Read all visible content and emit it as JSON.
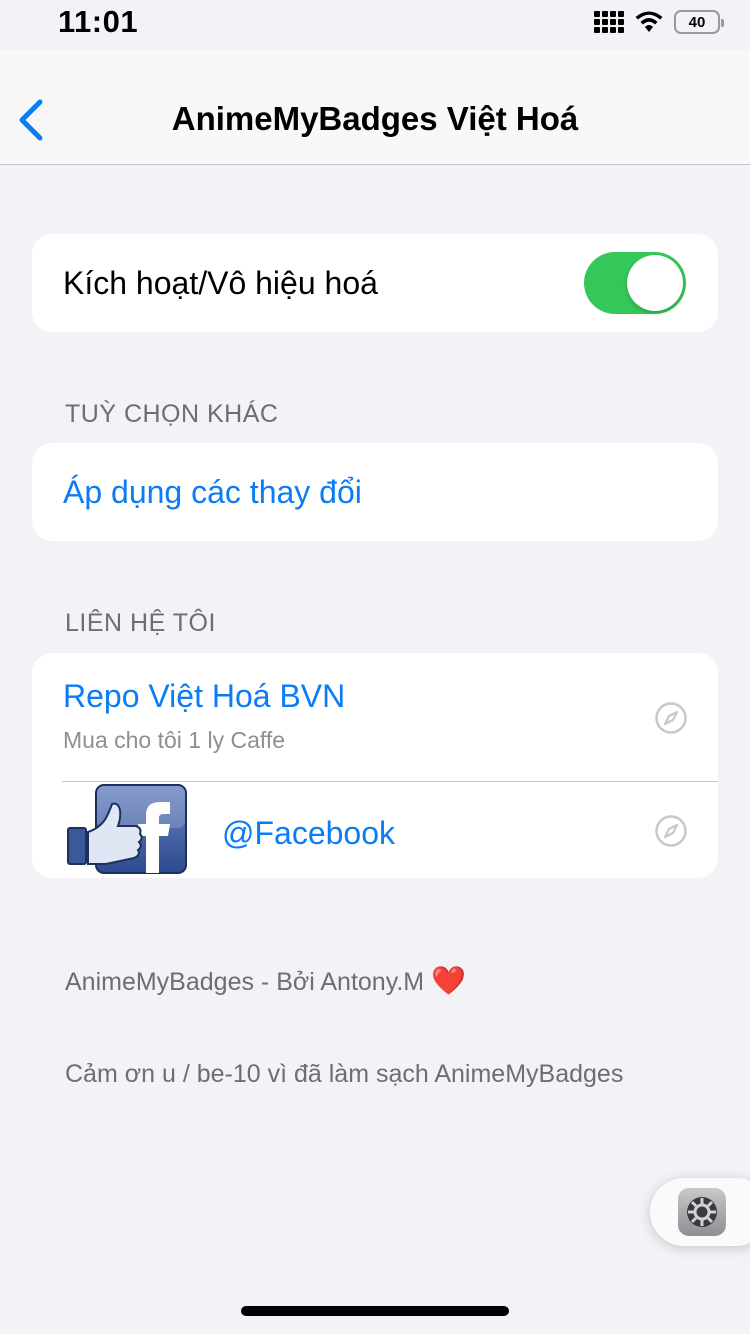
{
  "status_bar": {
    "time": "11:01",
    "battery": "40",
    "icons": [
      "signal-icon",
      "wifi-icon",
      "battery-icon"
    ]
  },
  "navbar": {
    "title": "AnimeMyBadges Việt Hoá",
    "back_icon": "chevron-left-icon"
  },
  "toggle_row": {
    "label": "Kích hoạt/Vô hiệu hoá",
    "enabled": true
  },
  "sections": {
    "other_options": "TUỲ CHỌN KHÁC",
    "contact": "LIÊN HỆ TÔI"
  },
  "apply": {
    "label": "Áp dụng các thay đổi"
  },
  "contact_rows": [
    {
      "title": "Repo Việt Hoá BVN",
      "subtitle": "Mua cho tôi 1 ly Caffe",
      "icon": "compass-icon"
    },
    {
      "title": "@Facebook",
      "icon": "facebook-like-icon"
    }
  ],
  "footer": {
    "credit": "AnimeMyBadges - Bởi Antony.M",
    "heart": "❤️",
    "thanks": "Cảm ơn u / be-10 vì đã làm sạch AnimeMyBadges"
  },
  "colors": {
    "background": "#f2f2f7",
    "accent": "#0a7cf5",
    "toggle_on": "#34c759",
    "secondary_text": "#6d6d72"
  }
}
